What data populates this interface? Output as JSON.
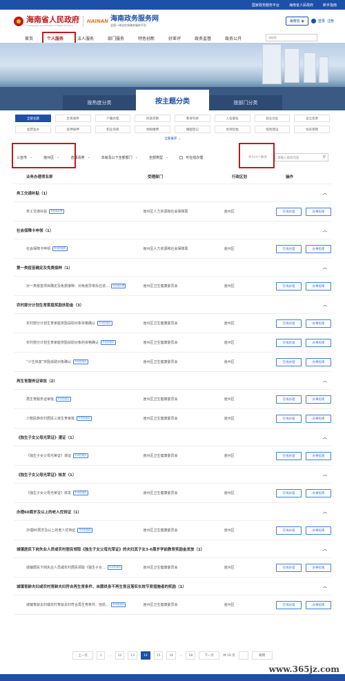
{
  "topbar": {
    "links": [
      "国家政务服务平台",
      "海南省人民政府",
      "新手指南"
    ]
  },
  "header": {
    "gov_title": "海南省人民政府",
    "gov_subtitle": "The People's Government of Hainan Province",
    "hainan_logo": "HAINAN",
    "service_title": "海南政务服务网",
    "service_subtitle": "全国一体化在线政务服务平台",
    "location": "海南省",
    "login": "登录",
    "register": "注册"
  },
  "nav": {
    "items": [
      "首页",
      "个人服务",
      "法人服务",
      "部门服务",
      "特色创新",
      "好差评",
      "政务监督",
      "政务公开"
    ],
    "search_placeholder": "请搜索"
  },
  "tabs": [
    "按热度分类",
    "按主题分类",
    "按部门分类"
  ],
  "categories": [
    "全部主题",
    "生育收养",
    "户籍办理",
    "民族宗教",
    "教育科研",
    "入伍服役",
    "就业创业",
    "设立变更",
    "准营准办",
    "抚押质押",
    "职业资格",
    "纳税缴费",
    "婚姻登记",
    "优待抚恤",
    "规划建设",
    "住房保障"
  ],
  "expand": "全部展开",
  "filters": {
    "city": "三亚市",
    "district": "崖州区",
    "level1": "选择请类",
    "level2": "本级及以下全部部门",
    "type": "全部类型",
    "online": "可在线办理",
    "count": "共319个事项",
    "search_placeholder": "请输入搜索内容"
  },
  "table": {
    "headers": [
      "业务办理项名称",
      "受理部门",
      "行政区划",
      "操作"
    ],
    "online_label": "在线办理",
    "guide_label": "办事指南",
    "groups": [
      {
        "title": "务工交通补贴（1）",
        "rows": [
          {
            "name": "务工交通补贴",
            "badge": "可在线办理",
            "dept": "崖州区人力资源和社会保障局",
            "area": "崖州区"
          }
        ]
      },
      {
        "title": "社会保障卡申领（1）",
        "rows": [
          {
            "name": "社会保障卡申领",
            "badge": "不可在线办",
            "dept": "崖州区人力资源和社会保障局",
            "area": "崖州区"
          }
        ]
      },
      {
        "title": "第一类疫苗确定及免费接种（1）",
        "rows": [
          {
            "name": "对一类疫苗项目确定及免费接种、对免疫异常反应进...",
            "badge": "可在线办理",
            "dept": "崖州区卫生健康委员会",
            "area": "崖州区"
          }
        ]
      },
      {
        "title": "农村部分计划生育家庭奖励扶助金（3）",
        "rows": [
          {
            "name": "农村部分计划生育家庭奖励扶助对象资格确认",
            "badge": "不可在线办",
            "dept": "崖州区卫生健康委员会",
            "area": "崖州区"
          },
          {
            "name": "农村部分计划生育家庭奖励扶助对象的资格确认",
            "badge": "不可在线办",
            "dept": "崖州区卫生健康委员会",
            "area": "崖州区"
          },
          {
            "name": "“少生快富”奖励扶助对象确认",
            "badge": "不可在线办",
            "dept": "崖州区卫生健康委员会",
            "area": "崖州区"
          }
        ]
      },
      {
        "title": "再生育服务证审批（2）",
        "rows": [
          {
            "name": "再生育服务证审批",
            "badge": "不可在线办",
            "dept": "崖州区卫生健康委员会",
            "area": "崖州区"
          },
          {
            "name": "少数民族农村居民三孩生育审批",
            "badge": "不可在线办",
            "dept": "崖州区卫生健康委员会",
            "area": "崖州区"
          }
        ]
      },
      {
        "title": "《独生子女父母光荣证》漫证（1）",
        "rows": [
          {
            "name": "《独生子女父母光荣证》漫证",
            "badge": "不可在线办",
            "dept": "崖州区卫生健康委员会",
            "area": "崖州区"
          }
        ]
      },
      {
        "title": "《独生子女父母光荣证》核发（1）",
        "rows": [
          {
            "name": "《独生子女父母光荣证》核发",
            "badge": "不可在线办",
            "dept": "崖州区卫生健康委员会",
            "area": "崖州区"
          }
        ]
      },
      {
        "title": "办理60周岁及以上的老人优待证（1）",
        "rows": [
          {
            "name": "办理60周岁及以上的老人优待证",
            "badge": "不可在线办",
            "dept": "崖州区卫生健康委员会",
            "area": "崖州区"
          }
        ]
      },
      {
        "title": "城镇居民下岗失业人员或农村居民领取《独生子女父母光荣证》的夫妇其子女3-6周岁学前教育奖励金发放（1）",
        "rows": [
          {
            "name": "城镇居民下岗失业人员或农村居民领取《独生子女...",
            "badge": "不可在线办",
            "dept": "崖州区卫生健康委员会",
            "area": "崖州区"
          }
        ]
      },
      {
        "title": "城镇育龄夫妇或农村育龄夫妇符合再生育条件、自愿终身不再生育且落实长效节育措施者的奖励（1）",
        "rows": [
          {
            "name": "城镇育龄夫妇或农村育龄夫妇符合再生育条件、自愿...",
            "badge": "不可在线办",
            "dept": "崖州区卫生健康委员会",
            "area": "崖州区"
          }
        ]
      }
    ]
  },
  "pager": {
    "prev": "上一页",
    "next": "下一页",
    "pages": [
      "1",
      "...",
      "12",
      "13",
      "14",
      "15",
      "16",
      "...",
      "18"
    ],
    "current": "14",
    "total": "共 18 页",
    "go": "跳转"
  },
  "watermark": "www.365jz.com"
}
